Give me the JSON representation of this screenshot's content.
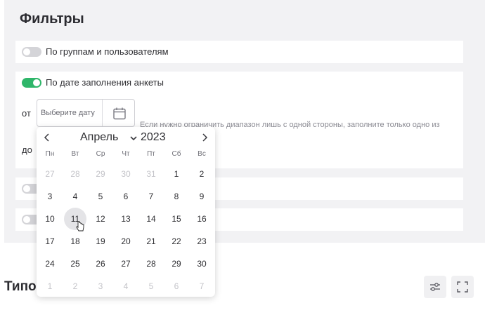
{
  "filters": {
    "title": "Фильтры",
    "by_groups_label": "По группам и пользователям",
    "by_date_label": "По дате заполнения анкеты",
    "from_label": "от",
    "to_label": "до",
    "date_placeholder": "Выберите дату",
    "hint": "Если нужно ограничить диапазон лишь с одной стороны, заполните только одно из"
  },
  "calendar": {
    "month": "Апрель",
    "year": "2023",
    "weekdays": [
      "Пн",
      "Вт",
      "Ср",
      "Чт",
      "Пт",
      "Сб",
      "Вс"
    ],
    "weeks": [
      [
        "27",
        "28",
        "29",
        "30",
        "31",
        "1",
        "2"
      ],
      [
        "3",
        "4",
        "5",
        "6",
        "7",
        "8",
        "9"
      ],
      [
        "10",
        "11",
        "12",
        "13",
        "14",
        "15",
        "16"
      ],
      [
        "17",
        "18",
        "19",
        "20",
        "21",
        "22",
        "23"
      ],
      [
        "24",
        "25",
        "26",
        "27",
        "28",
        "29",
        "30"
      ],
      [
        "1",
        "2",
        "3",
        "4",
        "5",
        "6",
        "7"
      ]
    ],
    "muted": [
      [
        true,
        true,
        true,
        true,
        true,
        false,
        false
      ],
      [
        false,
        false,
        false,
        false,
        false,
        false,
        false
      ],
      [
        false,
        false,
        false,
        false,
        false,
        false,
        false
      ],
      [
        false,
        false,
        false,
        false,
        false,
        false,
        false
      ],
      [
        false,
        false,
        false,
        false,
        false,
        false,
        false
      ],
      [
        true,
        true,
        true,
        true,
        true,
        true,
        true
      ]
    ],
    "hovered_day": "11"
  },
  "section": {
    "title": "Типо"
  },
  "colors": {
    "toggle_on": "#2fb66a",
    "toggle_off": "#d4d4d8",
    "panel_bg": "#f2f2f4"
  },
  "icons": {
    "calendar": "calendar-icon",
    "prev": "chevron-left-icon",
    "next": "chevron-right-icon",
    "settings": "sliders-icon",
    "expand": "fullscreen-icon"
  }
}
